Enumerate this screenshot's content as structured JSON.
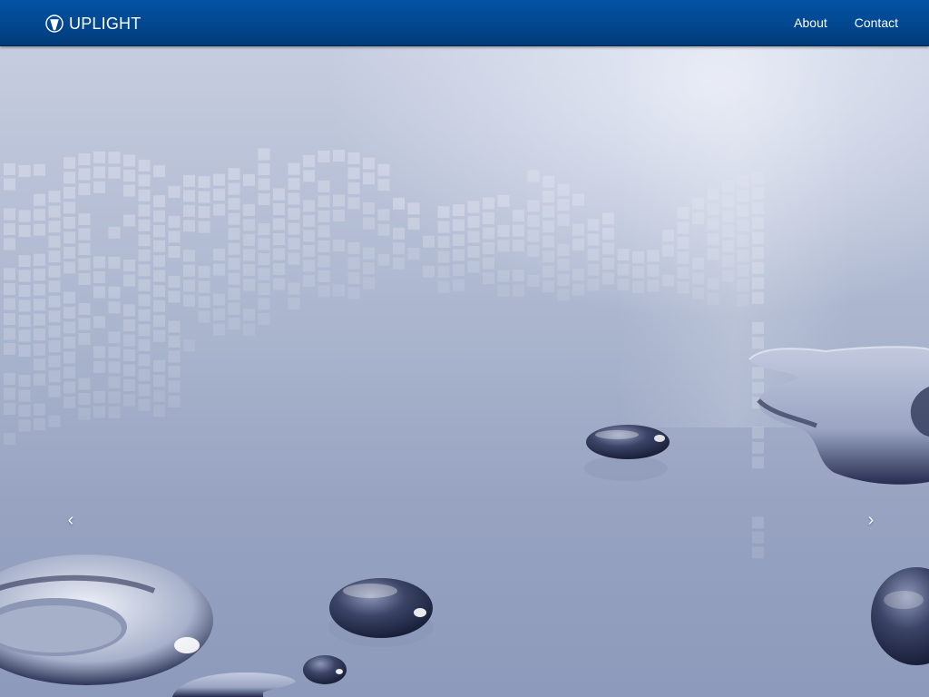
{
  "navbar": {
    "brand": {
      "label": "UPLIGHT",
      "icon": "uplight-logo-icon"
    },
    "links": [
      {
        "label": "About"
      },
      {
        "label": "Contact"
      }
    ],
    "colors": {
      "bar": "#02478f",
      "text": "#ffffff"
    }
  },
  "carousel": {
    "prev_label": "‹",
    "next_label": "›",
    "slide": {
      "image": "water-drops-pixel-grid-background"
    }
  }
}
